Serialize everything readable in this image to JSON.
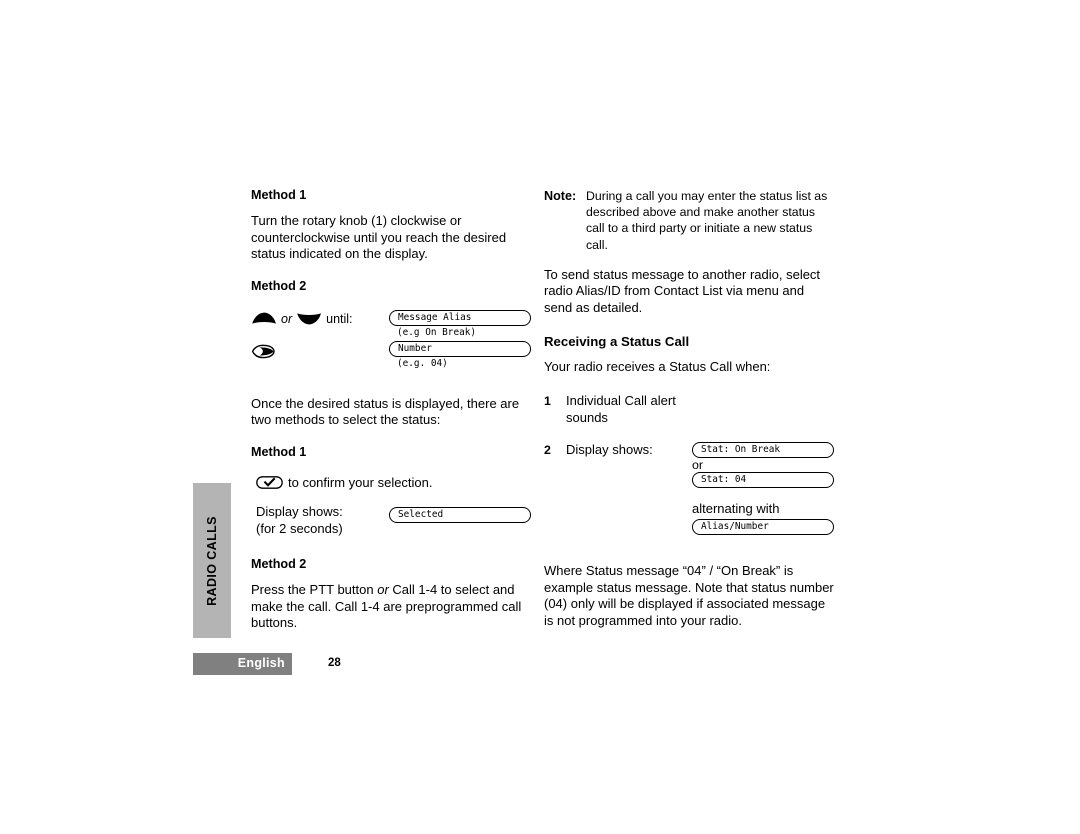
{
  "document": {
    "side_tab_label": "RADIO CALLS",
    "footer_language": "English",
    "page_number": "28"
  },
  "left_column": {
    "method1_heading": "Method 1",
    "method1_text": "Turn the rotary knob (1) clockwise or counterclockwise until you reach the desired status indicated on the display.",
    "method2_heading": "Method 2",
    "glyph_or": "or",
    "glyph_until": "until:",
    "lcd_message_alias": "Message Alias",
    "lcd_message_alias_example": "(e.g On Break)",
    "lcd_number": "Number",
    "lcd_number_example": "(e.g. 04)",
    "once_desired_text": "Once the desired status is displayed, there are two methods to select the status:",
    "select_method1_heading": "Method 1",
    "confirm_text": "to confirm your selection.",
    "display_shows_label": "Display shows:",
    "display_shows_duration": "(for 2 seconds)",
    "lcd_selected": "Selected",
    "select_method2_heading": "Method 2",
    "method2_ptt_pre": "Press the PTT button ",
    "method2_ptt_italic": "or",
    "method2_ptt_post": " Call 1-4 to select and make the call. Call 1-4 are preprogrammed call buttons."
  },
  "right_column": {
    "note_label": "Note:",
    "note_text": "During a call you may enter the status list as described above and make another status call to a third party or initiate a new status call.",
    "send_status_text": "To send status message to another radio, select radio Alias/ID from Contact List via menu and send as detailed.",
    "receiving_heading": "Receiving a Status Call",
    "receiving_intro": "Your radio receives a Status Call when:",
    "list": [
      {
        "num": "1",
        "text": "Individual Call alert sounds"
      },
      {
        "num": "2",
        "text": "Display shows:"
      }
    ],
    "lcd_stat_on_break": "Stat: On Break",
    "or_label": "or",
    "lcd_stat_04": "Stat: 04",
    "alternating_label": "alternating with",
    "lcd_alias_number": "Alias/Number",
    "where_status_text": "Where Status message “04” / “On Break” is example status message. Note that status number (04) only will be displayed if associated message is not programmed into your radio."
  },
  "colors": {
    "side_tab": "#b4b4b4",
    "footer_bar": "#808080",
    "text": "#000000",
    "page_background": "#ffffff"
  }
}
